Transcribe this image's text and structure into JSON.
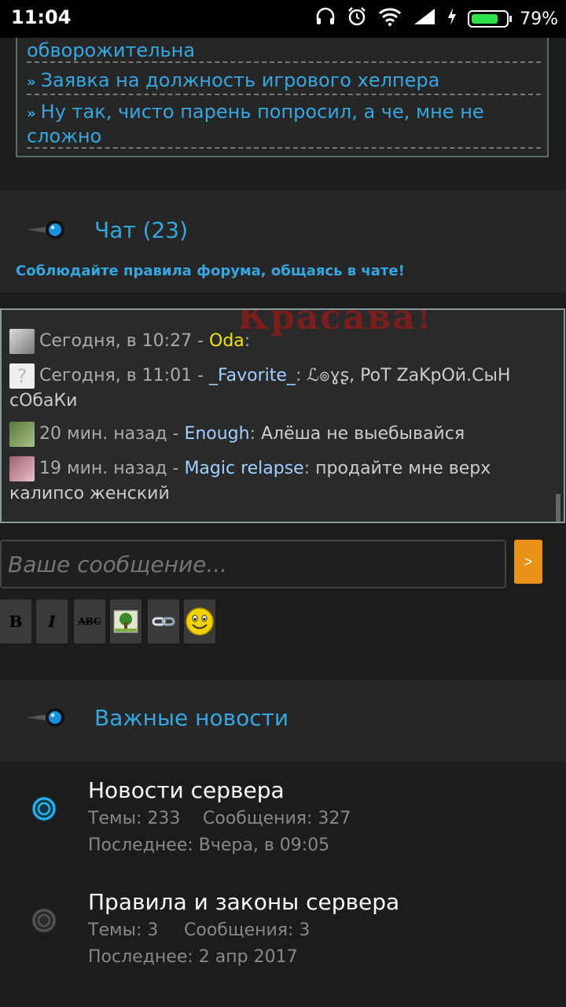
{
  "status": {
    "time": "11:04",
    "battery": "79%",
    "battery_level": 0.79
  },
  "links": [
    {
      "label": "обворожительна"
    },
    {
      "label": "Заявка на должность игрового хелпера"
    },
    {
      "label": "Ну так, чисто парень попросил, а че, мне не сложно"
    }
  ],
  "chat": {
    "title": "Чат (23)",
    "rules": "Соблюдайте правила форума, общаясь в чате!",
    "watermark": "Красава!",
    "messages": [
      {
        "time": "Сегодня, в 10:27 - ",
        "nick": "Oda",
        "sep": ":",
        "text": ""
      },
      {
        "time": "Сегодня, в 11:01 - ",
        "nick": "_Favorite_",
        "sep": ": ",
        "text": "ℒ๏ɣʂ, PoT ZaKpOй.СыН сОбаКи"
      },
      {
        "time": "20 мин. назад - ",
        "nick": "Enough",
        "sep": ": ",
        "text": "Алёша не выебывайся"
      },
      {
        "time": "19 мин. назад - ",
        "nick": "Magic relapse",
        "sep": ": ",
        "text": "продайте мне верх калипсо женский"
      }
    ],
    "input_placeholder": "Ваше сообщение...",
    "send_label": ">"
  },
  "toolbar": {
    "bold": "B",
    "italic": "I",
    "strike": "ABC"
  },
  "news": {
    "title": "Важные новости",
    "forums": [
      {
        "title": "Новости сервера",
        "topics": "Темы: 233",
        "posts": "Сообщения: 327",
        "last": "Последнее: Вчера, в 09:05",
        "active": true
      },
      {
        "title": "Правила и законы сервера",
        "topics": "Темы: 3",
        "posts": "Сообщения: 3",
        "last": "Последнее: 2 апр 2017",
        "active": false
      }
    ]
  },
  "colors": {
    "accent": "#35a7e0",
    "send": "#e8921a",
    "nick_admin": "#f2e400",
    "nick_user": "#9fd0ff"
  }
}
